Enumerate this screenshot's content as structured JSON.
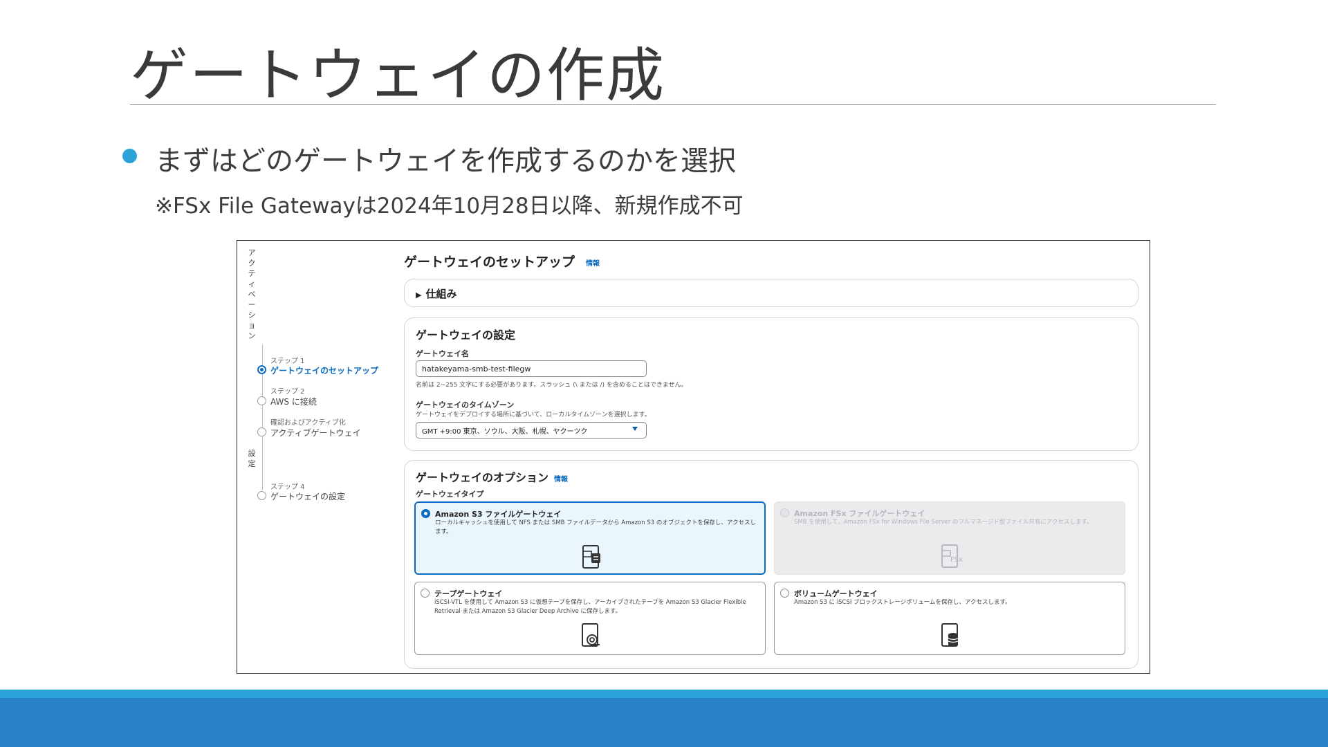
{
  "slide": {
    "title": "ゲートウェイの作成",
    "bullet": "まずはどのゲートウェイを作成するのかを選択",
    "note": "※FSx File Gatewayは2024年10月28日以降、新規作成不可"
  },
  "console": {
    "nav": {
      "section_label": "アクティベーション",
      "settings_label": "設定",
      "steps": [
        {
          "label": "ステップ 1",
          "name": "ゲートウェイのセットアップ",
          "active": true
        },
        {
          "label": "ステップ 2",
          "name": "AWS に接続",
          "active": false
        },
        {
          "label": "確認およびアクティブ化",
          "name": "アクティブゲートウェイ",
          "active": false
        },
        {
          "label": "ステップ 4",
          "name": "ゲートウェイの設定",
          "active": false
        }
      ]
    },
    "page_heading": "ゲートウェイのセットアップ",
    "info_link": "情報",
    "how_it_works": "仕組み",
    "settings": {
      "heading": "ゲートウェイの設定",
      "name_label": "ゲートウェイ名",
      "name_value": "hatakeyama-smb-test-filegw",
      "name_hint": "名前は 2~255 文字にする必要があります。スラッシュ (\\ または /) を含めることはできません。",
      "tz_label": "ゲートウェイのタイムゾーン",
      "tz_hint": "ゲートウェイをデプロイする場所に基づいて、ローカルタイムゾーンを選択します。",
      "tz_value": "GMT +9:00 東京、ソウル、大阪、札幌、ヤクーツク"
    },
    "options": {
      "heading": "ゲートウェイのオプション",
      "info_link": "情報",
      "type_label": "ゲートウェイタイプ",
      "types": [
        {
          "title": "Amazon S3 ファイルゲートウェイ",
          "desc": "ローカルキャッシュを使用して NFS または SMB ファイルデータから Amazon S3 のオブジェクトを保存し、アクセスします。",
          "selected": true,
          "disabled": false,
          "icon": "file-gateway-icon"
        },
        {
          "title": "Amazon FSx ファイルゲートウェイ",
          "desc": "SMB を使用して、Amazon FSx for Windows File Server のフルマネージド型ファイル共有にアクセスします。",
          "selected": false,
          "disabled": true,
          "icon": "fsx-gateway-icon",
          "icon_text": "FSx"
        },
        {
          "title": "テープゲートウェイ",
          "desc": "iSCSI-VTL を使用して Amazon S3 に仮想テープを保存し、アーカイブされたテープを Amazon S3 Glacier Flexible Retrieval または Amazon S3 Glacier Deep Archive に保存します。",
          "selected": false,
          "disabled": false,
          "icon": "tape-gateway-icon"
        },
        {
          "title": "ボリュームゲートウェイ",
          "desc": "Amazon S3 に iSCSI ブロックストレージボリュームを保存し、アクセスします。",
          "selected": false,
          "disabled": false,
          "icon": "volume-gateway-icon"
        }
      ]
    }
  },
  "colors": {
    "accent": "#29a3d8",
    "footer": "#2a83c6",
    "console_link": "#0a6bbf",
    "selected_tile_bg": "#eaf6fd"
  }
}
